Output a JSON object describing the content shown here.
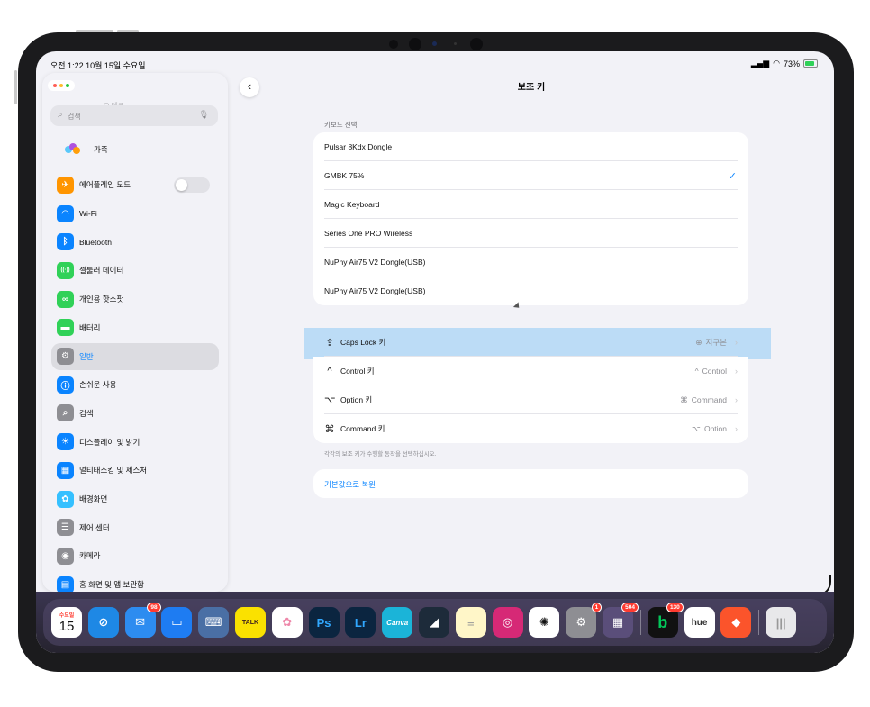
{
  "status_bar": {
    "time": "오전 1:22  10월 15일 수요일",
    "battery": "73%"
  },
  "sidebar": {
    "ghost_text": "Q 테크",
    "search_placeholder": "검색",
    "family": "가족",
    "airplane_label": "에어플레인 모드",
    "items": [
      {
        "label": "Wi-Fi",
        "icon": "wifi-icon",
        "color": "#0a84ff"
      },
      {
        "label": "Bluetooth",
        "icon": "bluetooth-icon",
        "color": "#0a84ff"
      },
      {
        "label": "셀룰러 데이터",
        "icon": "cellular-icon",
        "color": "#30d158"
      },
      {
        "label": "개인용 핫스팟",
        "icon": "hotspot-icon",
        "color": "#30d158"
      },
      {
        "label": "배터리",
        "icon": "battery-icon",
        "color": "#30d158"
      },
      {
        "label": "일반",
        "icon": "gear-icon",
        "color": "#8e8e93"
      },
      {
        "label": "손쉬운 사용",
        "icon": "accessibility-icon",
        "color": "#0a84ff"
      },
      {
        "label": "검색",
        "icon": "search-icon",
        "color": "#8e8e93"
      },
      {
        "label": "디스플레이 및 밝기",
        "icon": "brightness-icon",
        "color": "#0a84ff"
      },
      {
        "label": "멀티태스킹 및 제스처",
        "icon": "multitasking-icon",
        "color": "#0a84ff"
      },
      {
        "label": "배경화면",
        "icon": "wallpaper-icon",
        "color": "#35c0ff"
      },
      {
        "label": "제어 센터",
        "icon": "control-center-icon",
        "color": "#8e8e93"
      },
      {
        "label": "카메라",
        "icon": "camera-icon",
        "color": "#8e8e93"
      },
      {
        "label": "홈 화면 및 앱 보관함",
        "icon": "home-screen-icon",
        "color": "#0a84ff"
      }
    ]
  },
  "main": {
    "title": "보조 키",
    "section_label": "키보드 선택",
    "keyboards": [
      {
        "label": "Pulsar 8Kdx Dongle",
        "selected": false
      },
      {
        "label": "GMBK 75%",
        "selected": true
      },
      {
        "label": "Magic Keyboard",
        "selected": false
      },
      {
        "label": "Series One PRO Wireless",
        "selected": false
      },
      {
        "label": "NuPhy Air75 V2 Dongle(USB)",
        "selected": false
      },
      {
        "label": "NuPhy Air75 V2 Dongle(USB)",
        "selected": false
      }
    ],
    "modifiers": [
      {
        "key_icon": "⇪",
        "label": "Caps Lock 키",
        "value_icon": "globe-icon",
        "value": "지구본"
      },
      {
        "key_icon": "^",
        "label": "Control 키",
        "value_icon": "^",
        "value": "Control"
      },
      {
        "key_icon": "⌥",
        "label": "Option 키",
        "value_icon": "⌘",
        "value": "Command"
      },
      {
        "key_icon": "⌘",
        "label": "Command 키",
        "value_icon": "⌥",
        "value": "Option"
      }
    ],
    "footer": "각각의 보조 키가 수행할 동작을 선택하십시오.",
    "reset_label": "기본값으로 복원"
  },
  "dock": {
    "calendar_day": "수요일",
    "calendar_date": "15",
    "badges": {
      "mail": "98",
      "settings": "1",
      "folder": "504",
      "blog": "130"
    },
    "app_labels": {
      "kakao": "TALK",
      "ps": "Ps",
      "lr": "Lr",
      "canva": "Canva",
      "blog": "b",
      "hue": "hue"
    }
  }
}
